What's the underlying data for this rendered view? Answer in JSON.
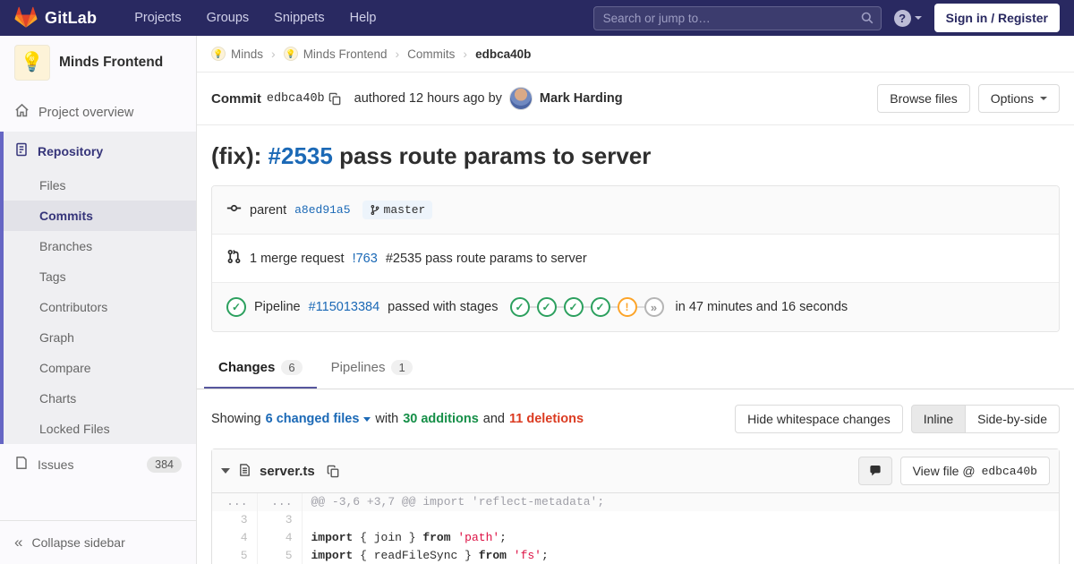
{
  "icons": {
    "help": "?",
    "collapse": "«",
    "separator": "›",
    "lightbulb": "💡"
  },
  "navbar": {
    "brand": "GitLab",
    "links": [
      "Projects",
      "Groups",
      "Snippets",
      "Help"
    ],
    "search_placeholder": "Search or jump to…",
    "sign_in": "Sign in / Register"
  },
  "sidebar": {
    "project_name": "Minds Frontend",
    "overview": "Project overview",
    "repository": {
      "label": "Repository",
      "items": [
        "Files",
        "Commits",
        "Branches",
        "Tags",
        "Contributors",
        "Graph",
        "Compare",
        "Charts",
        "Locked Files"
      ],
      "active_item": "Commits"
    },
    "issues": {
      "label": "Issues",
      "count": "384"
    },
    "collapse_label": "Collapse sidebar"
  },
  "breadcrumb": {
    "crumbs": [
      "Minds",
      "Minds Frontend",
      "Commits",
      "edbca40b"
    ]
  },
  "commit": {
    "label": "Commit",
    "sha": "edbca40b",
    "authored": "authored 12 hours ago by",
    "author": "Mark Harding",
    "browse_files": "Browse files",
    "options": "Options"
  },
  "title": {
    "prefix": "(fix): ",
    "issue": "#2535",
    "suffix": " pass route params to server"
  },
  "parent_row": {
    "label": "parent",
    "sha": "a8ed91a5",
    "branch": "master"
  },
  "merge_row": {
    "text": "1 merge request",
    "link": "!763",
    "rest": "#2535 pass route params to server"
  },
  "pipeline": {
    "label": "Pipeline",
    "id": "#115013384",
    "status_text": "passed with stages",
    "duration": "in 47 minutes and 16 seconds",
    "stages": [
      {
        "status": "passed",
        "glyph": "✓"
      },
      {
        "status": "passed",
        "glyph": "✓"
      },
      {
        "status": "passed",
        "glyph": "✓"
      },
      {
        "status": "passed",
        "glyph": "✓"
      },
      {
        "status": "warning",
        "glyph": "!"
      },
      {
        "status": "skipped",
        "glyph": "»"
      }
    ]
  },
  "tabs": {
    "changes": "Changes",
    "changes_count": "6",
    "pipelines": "Pipelines",
    "pipelines_count": "1"
  },
  "controls": {
    "showing": "Showing",
    "changed_files": "6 changed files",
    "with": "with",
    "additions": "30 additions",
    "and": "and",
    "deletions": "11 deletions",
    "hide_whitespace": "Hide whitespace changes",
    "inline": "Inline",
    "side_by_side": "Side-by-side"
  },
  "diff": {
    "file_name": "server.ts",
    "view_file": "View file @",
    "view_sha": "edbca40b",
    "rows": [
      {
        "old": "...",
        "new": "...",
        "hunk": "@@ -3,6 +3,7 @@ import 'reflect-metadata';"
      },
      {
        "old": "3",
        "new": "3"
      },
      {
        "old": "4",
        "new": "4",
        "s0": "import",
        "s1": " { join } ",
        "s2": "from",
        "s3": " ",
        "s4": "'path'",
        "s5": ";"
      },
      {
        "old": "5",
        "new": "5",
        "s0": "import",
        "s1": " { readFileSync } ",
        "s2": "from",
        "s3": " ",
        "s4": "'fs'",
        "s5": ";"
      }
    ]
  },
  "colors": {
    "navbar": "#292961",
    "link": "#1b69b6",
    "green": "#168f48",
    "red": "#db3b21",
    "warning": "#fc9403",
    "indigo": "#6666c4"
  }
}
